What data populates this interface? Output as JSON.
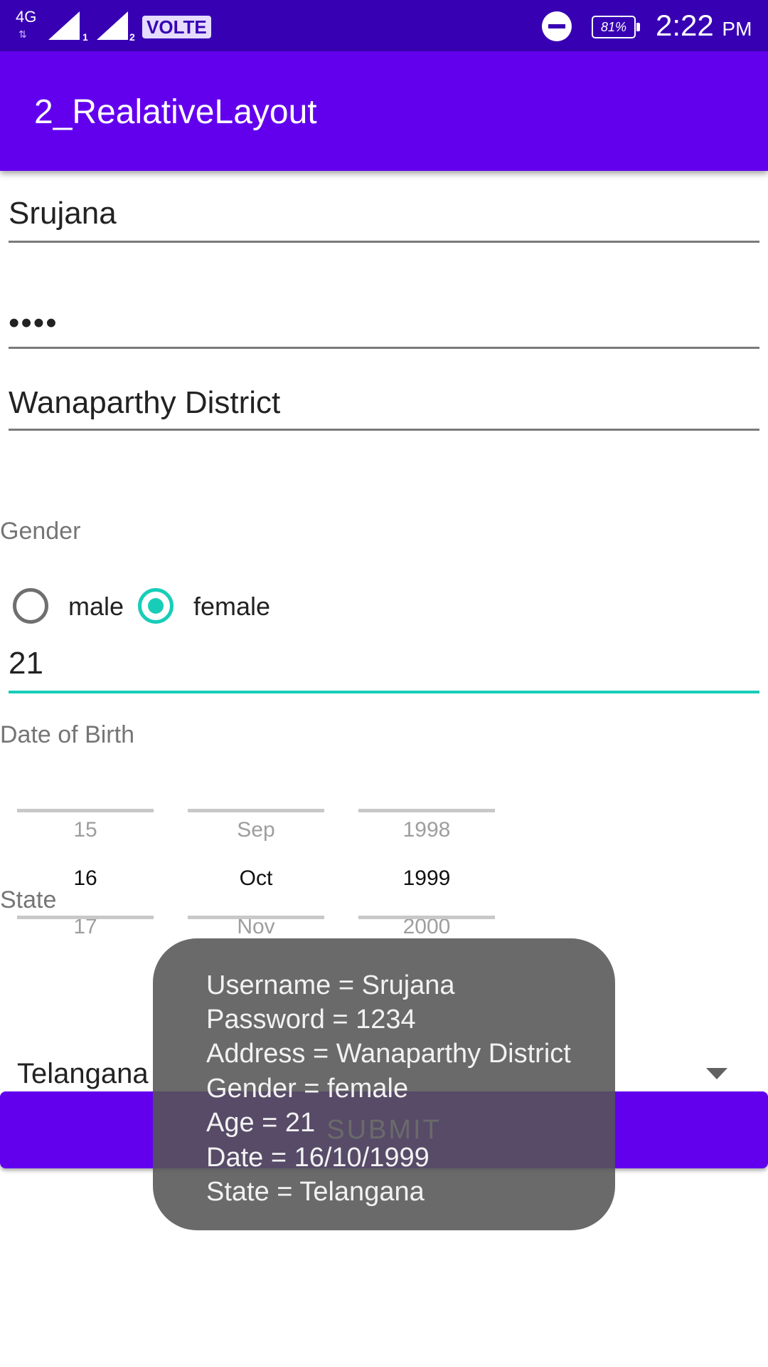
{
  "status_bar": {
    "network": "4G",
    "sim1": "1",
    "sim2": "2",
    "volte": "VOLTE",
    "battery": "81%",
    "time": "2:22",
    "ampm": "PM"
  },
  "app_bar": {
    "title": "2_RealativeLayout"
  },
  "form": {
    "username_value": "Srujana",
    "password_value": "••••",
    "address_value": "Wanaparthy District",
    "gender_label": "Gender",
    "gender_options": [
      {
        "label": "male",
        "checked": false
      },
      {
        "label": "female",
        "checked": true
      }
    ],
    "age_value": "21",
    "dob_label": "Date of Birth",
    "date_picker": {
      "day": {
        "prev": "15",
        "selected": "16",
        "next": "17"
      },
      "month": {
        "prev": "Sep",
        "selected": "Oct",
        "next": "Nov"
      },
      "year": {
        "prev": "1998",
        "selected": "1999",
        "next": "2000"
      }
    },
    "state_label": "State",
    "state_value": "Telangana",
    "submit_label": "SUBMIT"
  },
  "toast": {
    "lines": [
      "Username = Srujana",
      "Password = 1234",
      "Address = Wanaparthy District",
      "Gender = female",
      "Age = 21",
      "Date = 16/10/1999",
      "State = Telangana"
    ]
  },
  "colors": {
    "status_bar": "#3700b3",
    "primary": "#6200ee",
    "accent": "#18cdb8"
  }
}
